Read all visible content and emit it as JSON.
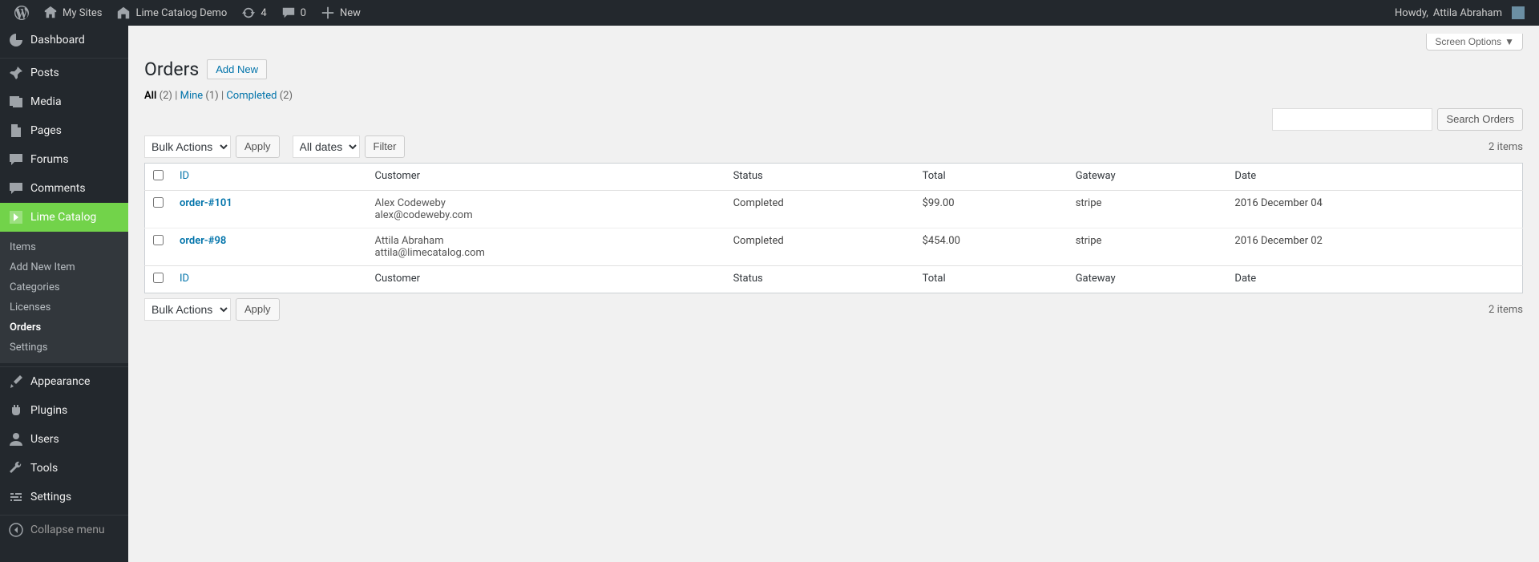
{
  "admin_bar": {
    "my_sites": "My Sites",
    "site_name": "Lime Catalog Demo",
    "updates": "4",
    "comments": "0",
    "new": "New",
    "howdy_prefix": "Howdy, ",
    "user_name": "Attila Abraham"
  },
  "sidebar": {
    "items": [
      {
        "key": "dashboard",
        "label": "Dashboard"
      },
      {
        "key": "posts",
        "label": "Posts"
      },
      {
        "key": "media",
        "label": "Media"
      },
      {
        "key": "pages",
        "label": "Pages"
      },
      {
        "key": "forums",
        "label": "Forums"
      },
      {
        "key": "comments",
        "label": "Comments"
      },
      {
        "key": "lime_catalog",
        "label": "Lime Catalog"
      },
      {
        "key": "appearance",
        "label": "Appearance"
      },
      {
        "key": "plugins",
        "label": "Plugins"
      },
      {
        "key": "users",
        "label": "Users"
      },
      {
        "key": "tools",
        "label": "Tools"
      },
      {
        "key": "settings",
        "label": "Settings"
      },
      {
        "key": "collapse",
        "label": "Collapse menu"
      }
    ],
    "submenu": [
      {
        "key": "items",
        "label": "Items"
      },
      {
        "key": "add_new_item",
        "label": "Add New Item"
      },
      {
        "key": "categories",
        "label": "Categories"
      },
      {
        "key": "licenses",
        "label": "Licenses"
      },
      {
        "key": "orders",
        "label": "Orders"
      },
      {
        "key": "settings",
        "label": "Settings"
      }
    ]
  },
  "screen_options": "Screen Options",
  "page": {
    "title": "Orders",
    "add_new": "Add New"
  },
  "filters": {
    "all": "All",
    "all_count": "(2)",
    "mine": "Mine",
    "mine_count": "(1)",
    "completed": "Completed",
    "completed_count": "(2)",
    "separator": "  |  "
  },
  "bulk_actions": "Bulk Actions",
  "apply": "Apply",
  "all_dates": "All dates",
  "filter_btn": "Filter",
  "items_count": "2 items",
  "search_button": "Search Orders",
  "search_value": "",
  "columns": {
    "id": "ID",
    "customer": "Customer",
    "status": "Status",
    "total": "Total",
    "gateway": "Gateway",
    "date": "Date"
  },
  "rows": [
    {
      "id": "order-#101",
      "customer_name": "Alex Codeweby",
      "customer_email": "alex@codeweby.com",
      "status": "Completed",
      "total": "$99.00",
      "gateway": "stripe",
      "date": "2016 December 04"
    },
    {
      "id": "order-#98",
      "customer_name": "Attila Abraham",
      "customer_email": "attila@limecatalog.com",
      "status": "Completed",
      "total": "$454.00",
      "gateway": "stripe",
      "date": "2016 December 02"
    }
  ]
}
